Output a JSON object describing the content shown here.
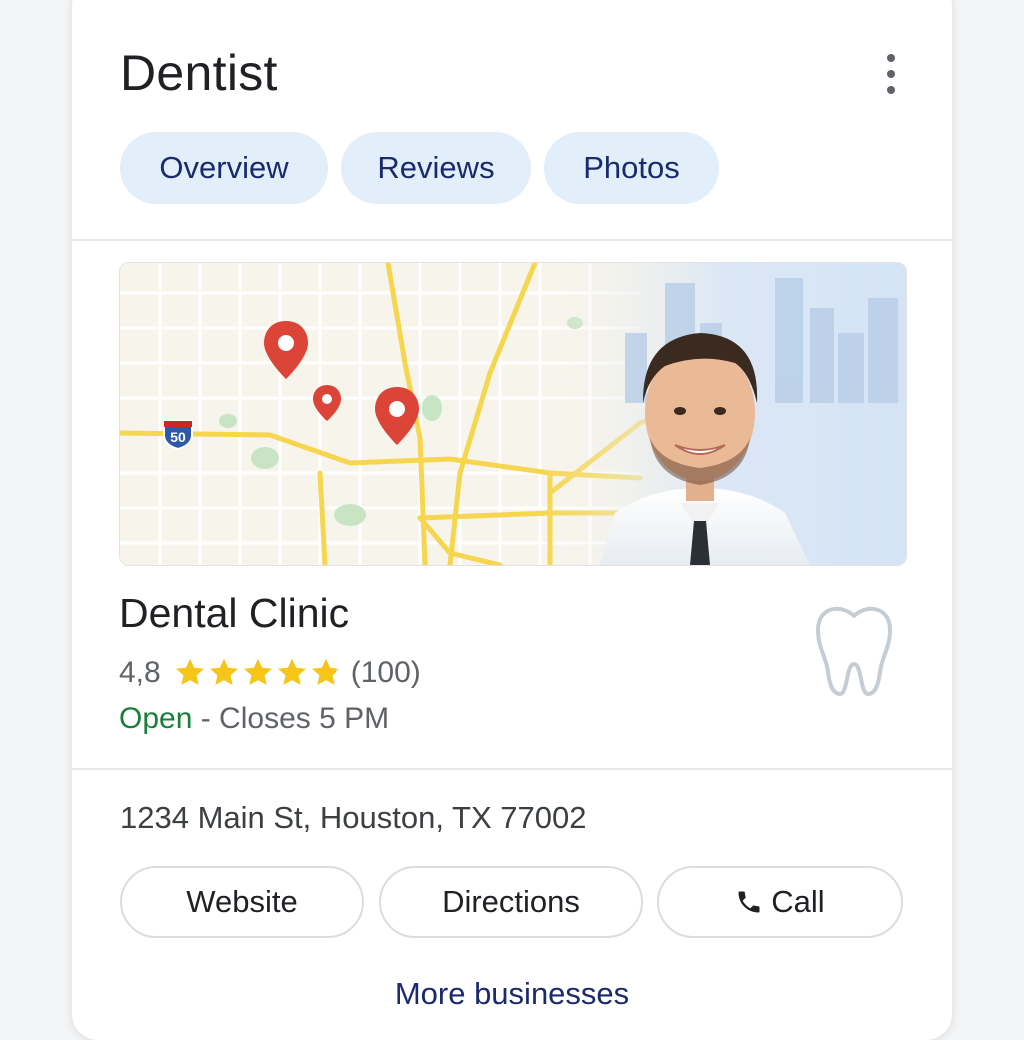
{
  "header": {
    "title": "Dentist",
    "menu_icon": "more-vertical-icon"
  },
  "tabs": [
    {
      "label": "Overview"
    },
    {
      "label": "Reviews"
    },
    {
      "label": "Photos"
    }
  ],
  "map": {
    "highway_shield": "50",
    "pin_count": 3
  },
  "business": {
    "name": "Dental Clinic",
    "rating": "4,8",
    "rating_value": 4.8,
    "rating_max": 5,
    "review_count": "(100)",
    "status": "Open",
    "hours": " - Closes 5 PM",
    "address": "1234 Main St, Houston, TX 77002",
    "icon": "tooth-icon"
  },
  "actions": {
    "website": "Website",
    "directions": "Directions",
    "call": "Call",
    "call_icon": "phone-icon"
  },
  "footer": {
    "more_link": "More businesses"
  },
  "colors": {
    "chip_bg": "#e3eefb",
    "chip_text": "#1a2a6c",
    "star": "#f5c518",
    "open": "#188038",
    "pin": "#db4437",
    "road": "#f6d64e"
  }
}
